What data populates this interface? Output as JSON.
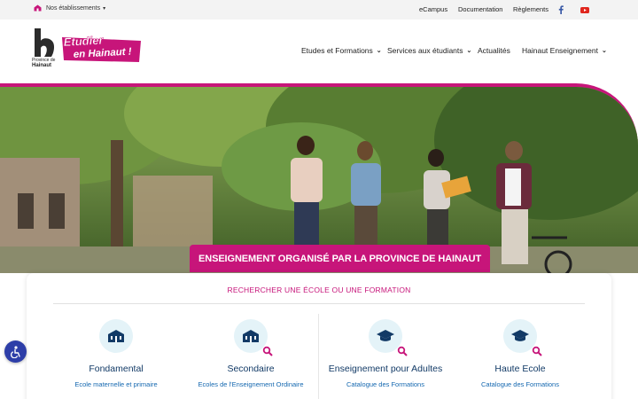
{
  "topbar": {
    "establishments_label": "Nos établissements",
    "links": [
      "eCampus",
      "Documentation",
      "Règlements"
    ],
    "social": [
      "facebook-icon",
      "youtube-icon"
    ]
  },
  "header": {
    "logo_line1": "Province de",
    "logo_line2": "Hainaut",
    "sticker_line1": "Etudier",
    "sticker_line2": "en Hainaut !",
    "nav": [
      {
        "label": "Etudes et Formations"
      },
      {
        "label": "Services aux étudiants"
      },
      {
        "label": "Actualités"
      },
      {
        "label": "Hainaut Enseignement"
      }
    ]
  },
  "hero": {
    "banner": "ENSEIGNEMENT ORGANISÉ PAR LA PROVINCE DE HAINAUT"
  },
  "search": {
    "title": "RECHERCHER UNE ÉCOLE OU UNE FORMATION",
    "categories": [
      {
        "name": "Fondamental",
        "sub": "Ecole maternelle et primaire",
        "icon": "school-icon"
      },
      {
        "name": "Secondaire",
        "sub": "Ecoles de l'Enseignement Ordinaire",
        "icon": "school-search-icon"
      },
      {
        "name": "Enseignement pour Adultes",
        "sub": "Catalogue des Formations",
        "icon": "graduation-cap-search-icon"
      },
      {
        "name": "Haute Ecole",
        "sub": "Catalogue des Formations",
        "icon": "graduation-cap-search-icon"
      }
    ]
  },
  "colors": {
    "brand": "#c7157a",
    "navy": "#123a66",
    "link": "#1568b0",
    "icon_bg": "#e4f3f8"
  }
}
